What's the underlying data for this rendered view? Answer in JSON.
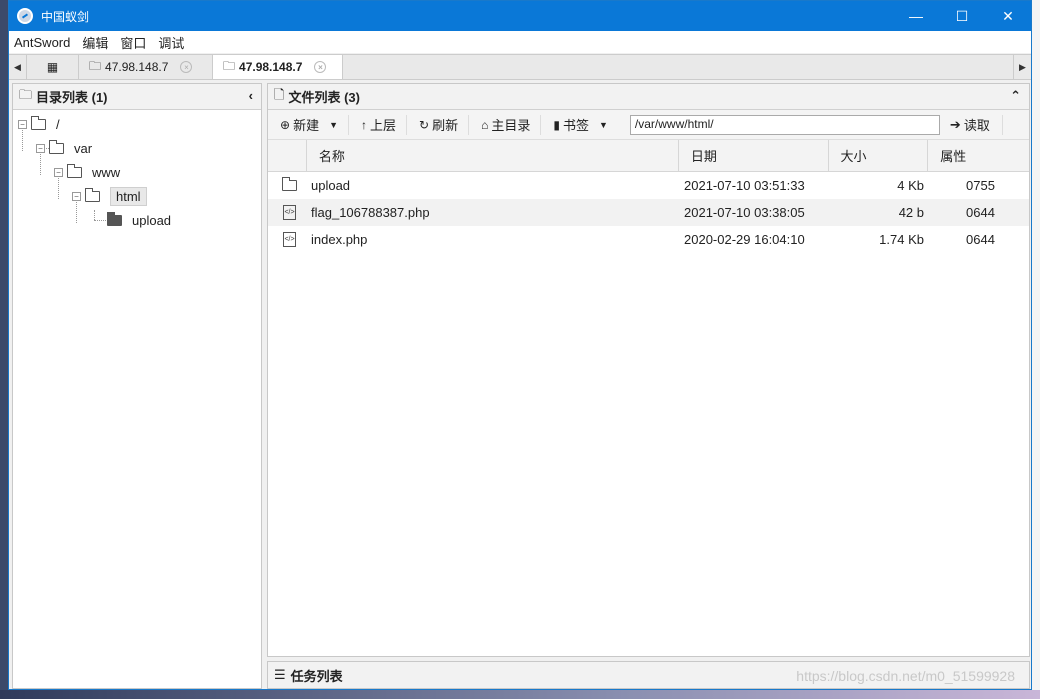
{
  "window": {
    "title": "中国蚁剑",
    "controls": {
      "minimize": "—",
      "maximize": "☐",
      "close": "✕"
    }
  },
  "menu": [
    "AntSword",
    "编辑",
    "窗口",
    "调试"
  ],
  "tabs": [
    {
      "label": "47.98.148.7",
      "close": "×"
    },
    {
      "label": "47.98.148.7",
      "close": "×"
    }
  ],
  "dir_panel": {
    "title": "目录列表 (1)",
    "collapse": "‹"
  },
  "tree": {
    "root": "/",
    "var": "var",
    "www": "www",
    "html": "html",
    "upload": "upload"
  },
  "file_panel": {
    "title": "文件列表 (3)",
    "collapse": "⌃"
  },
  "toolbar": {
    "new": "新建",
    "up": "上层",
    "refresh": "刷新",
    "home": "主目录",
    "bookmark": "书签",
    "path": "/var/www/html/",
    "read": "读取"
  },
  "columns": {
    "name": "名称",
    "date": "日期",
    "size": "大小",
    "attr": "属性"
  },
  "files": [
    {
      "name": "upload",
      "date": "2021-07-10 03:51:33",
      "size": "4 Kb",
      "attr": "0755",
      "icon": "folder-icon"
    },
    {
      "name": "flag_106788387.php",
      "date": "2021-07-10 03:38:05",
      "size": "42 b",
      "attr": "0644",
      "icon": "code-file-icon"
    },
    {
      "name": "index.php",
      "date": "2020-02-29 16:04:10",
      "size": "1.74 Kb",
      "attr": "0644",
      "icon": "code-file-icon"
    }
  ],
  "task_panel": {
    "title": "任务列表",
    "watermark": "https://blog.csdn.net/m0_51599928"
  }
}
